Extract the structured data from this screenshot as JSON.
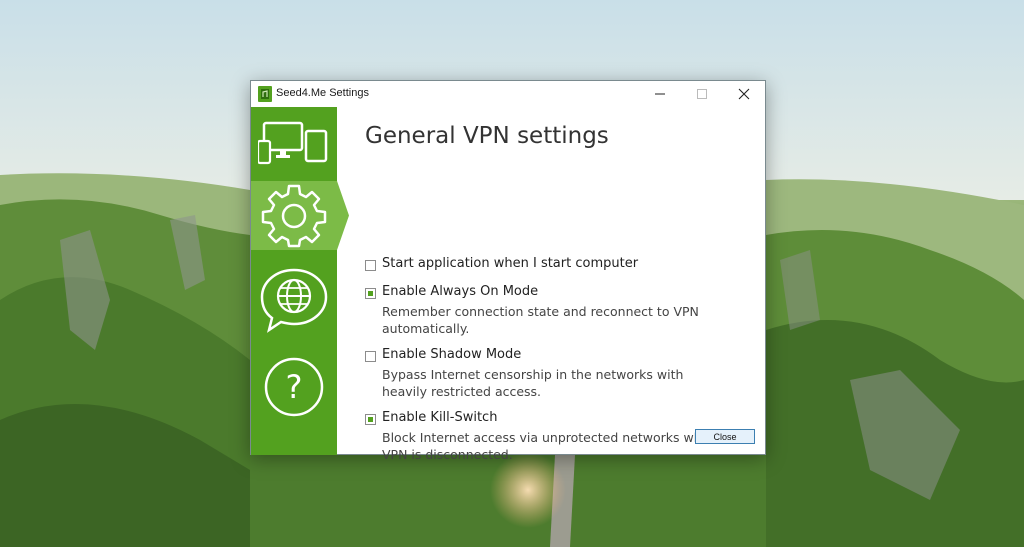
{
  "window": {
    "title": "Seed4.Me Settings"
  },
  "content": {
    "title": "General VPN settings",
    "options": [
      {
        "label": "Start application when I start computer",
        "description": "",
        "checked": false
      },
      {
        "label": "Enable Always On Mode",
        "description": "Remember connection state and reconnect to VPN automatically.",
        "checked": true
      },
      {
        "label": "Enable Shadow Mode",
        "description": "Bypass Internet censorship in the networks with heavily restricted access.",
        "checked": false
      },
      {
        "label": "Enable Kill-Switch",
        "description": "Block Internet access via unprotected networks when VPN is disconnected.",
        "checked": true
      }
    ],
    "close_label": "Close"
  },
  "sidebar": {
    "items": [
      {
        "icon": "devices-icon",
        "active": false
      },
      {
        "icon": "gear-icon",
        "active": true
      },
      {
        "icon": "globe-chat-icon",
        "active": false
      },
      {
        "icon": "help-icon",
        "active": false
      }
    ]
  },
  "colors": {
    "accent": "#53a11f",
    "accent_active": "#7cbb47"
  }
}
